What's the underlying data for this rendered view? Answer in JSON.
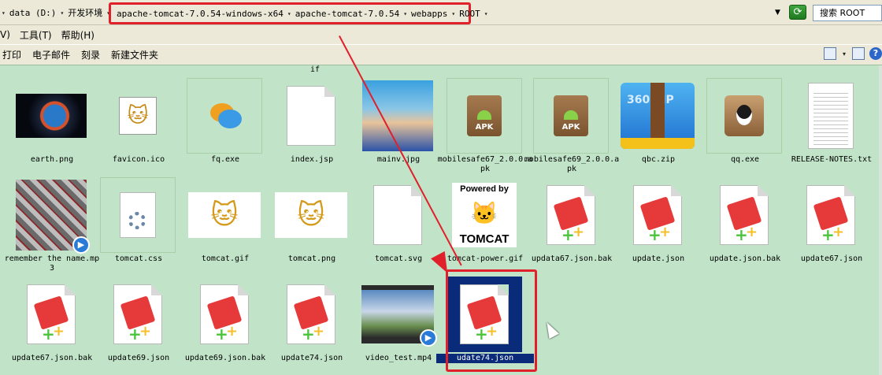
{
  "address": {
    "crumbs_prefix": [
      "data (D:)",
      "开发环境"
    ],
    "crumbs_path": [
      "apache-tomcat-7.0.54-windows-x64",
      "apache-tomcat-7.0.54",
      "webapps",
      "ROOT"
    ],
    "search": "搜索 ROOT"
  },
  "menus": [
    "V)",
    "工具(T)",
    "帮助(H)"
  ],
  "toolbar": [
    "打印",
    "电子邮件",
    "刻录",
    "新建文件夹"
  ],
  "stray_label": "if",
  "files": [
    {
      "name": "earth.png",
      "icon": "earth-image"
    },
    {
      "name": "favicon.ico",
      "icon": "tomcat-favicon"
    },
    {
      "name": "fq.exe",
      "icon": "chat-app-icon"
    },
    {
      "name": "index.jsp",
      "icon": "blank-document"
    },
    {
      "name": "mainv.jpg",
      "icon": "photo-image"
    },
    {
      "name": "mobilesafe67_2.0.0.apk",
      "icon": "apk-package"
    },
    {
      "name": "mobilesafe69_2.0.0.apk",
      "icon": "apk-package"
    },
    {
      "name": "qbc.zip",
      "icon": "zip-archive"
    },
    {
      "name": "qq.exe",
      "icon": "qq-app"
    },
    {
      "name": "RELEASE-NOTES.txt",
      "icon": "text-document"
    },
    {
      "name": "remember the name.mp3",
      "icon": "music-file"
    },
    {
      "name": "tomcat.css",
      "icon": "settings-document"
    },
    {
      "name": "tomcat.gif",
      "icon": "tomcat-image"
    },
    {
      "name": "tomcat.png",
      "icon": "tomcat-image"
    },
    {
      "name": "tomcat.svg",
      "icon": "blank-document"
    },
    {
      "name": "tomcat-power.gif",
      "icon": "tomcat-powered-image"
    },
    {
      "name": "updata67.json.bak",
      "icon": "notepad-document"
    },
    {
      "name": "update.json",
      "icon": "notepad-document"
    },
    {
      "name": "update.json.bak",
      "icon": "notepad-document"
    },
    {
      "name": "update67.json",
      "icon": "notepad-document"
    },
    {
      "name": "update67.json.bak",
      "icon": "notepad-document"
    },
    {
      "name": "update69.json",
      "icon": "notepad-document"
    },
    {
      "name": "update69.json.bak",
      "icon": "notepad-document"
    },
    {
      "name": "update74.json",
      "icon": "notepad-document"
    },
    {
      "name": "video_test.mp4",
      "icon": "video-file"
    },
    {
      "name": "udate74.json",
      "icon": "notepad-document",
      "selected": true
    }
  ],
  "thumb_text": {
    "zip": "360 ZIP",
    "apk": "APK",
    "powered_by": "Powered by",
    "tomcat_word": "TOMCAT"
  },
  "colors": {
    "highlight": "#e0202a",
    "selection": "#0a2a7a",
    "pane": "#c1e4c9"
  }
}
